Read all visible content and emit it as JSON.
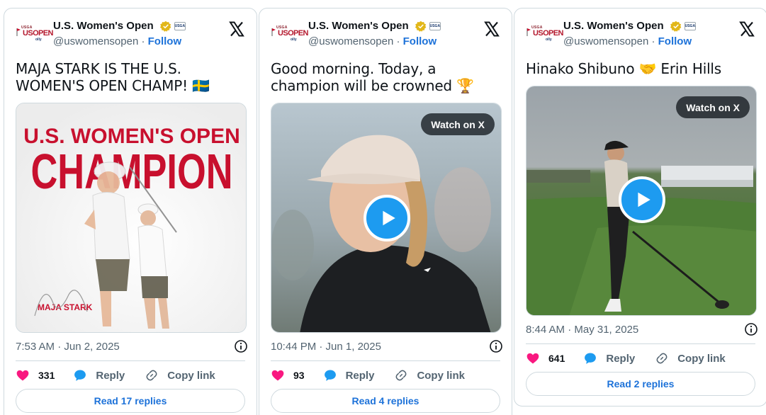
{
  "account": {
    "name": "U.S. Women's Open",
    "handle": "@uswomensopen",
    "separator": "·",
    "follow_label": "Follow",
    "logo_text": "USOPEN",
    "logo_small_top": "USGA",
    "logo_small_bottom": "olly",
    "affiliate_text": "USGA"
  },
  "colors": {
    "accent": "#1d9bf0",
    "link": "#1d72d9",
    "like": "#f91880",
    "brand_red": "#c8102e"
  },
  "tweets": [
    {
      "text": "MAJA STARK IS THE U.S. WOMEN'S OPEN CHAMP! 🇸🇪",
      "media_type": "image",
      "media_headline": "U.S. WOMEN'S OPEN",
      "media_headline_big": "CHAMPION",
      "media_caption": "MAJA STARK",
      "timestamp": "7:53 AM · Jun 2, 2025",
      "likes": "331",
      "reply_label": "Reply",
      "copy_label": "Copy link",
      "replies_button": "Read 17 replies"
    },
    {
      "text": "Good morning. Today, a champion will be crowned 🏆",
      "media_type": "video",
      "watch_label": "Watch on X",
      "timestamp": "10:44 PM · Jun 1, 2025",
      "likes": "93",
      "reply_label": "Reply",
      "copy_label": "Copy link",
      "replies_button": "Read 4 replies"
    },
    {
      "text": "Hinako Shibuno 🤝 Erin Hills",
      "media_type": "video",
      "watch_label": "Watch on X",
      "timestamp": "8:44 AM · May 31, 2025",
      "likes": "641",
      "reply_label": "Reply",
      "copy_label": "Copy link",
      "replies_button": "Read 2 replies"
    }
  ]
}
